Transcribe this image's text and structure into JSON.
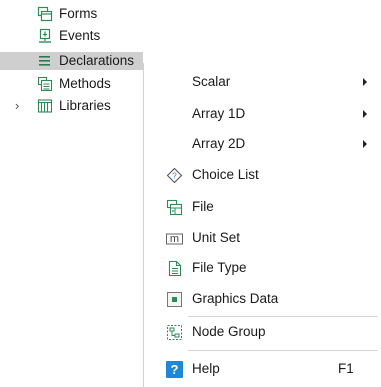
{
  "tree": {
    "items": [
      {
        "label": "Forms",
        "icon": "forms-icon"
      },
      {
        "label": "Events",
        "icon": "events-icon"
      },
      {
        "label": "Declarations",
        "icon": "declarations-icon",
        "selected": true
      },
      {
        "label": "Methods",
        "icon": "methods-icon"
      },
      {
        "label": "Libraries",
        "icon": "libraries-icon",
        "expander": "›"
      }
    ]
  },
  "menu": {
    "items": [
      {
        "label": "Scalar",
        "submenu": true
      },
      {
        "label": "Array 1D",
        "submenu": true
      },
      {
        "label": "Array 2D",
        "submenu": true
      },
      {
        "label": "Choice List",
        "icon": "choice-list-icon"
      },
      {
        "label": "File",
        "icon": "file-icon"
      },
      {
        "label": "Unit Set",
        "icon": "unit-set-icon",
        "icon_text": "m"
      },
      {
        "label": "File Type",
        "icon": "file-type-icon"
      },
      {
        "label": "Graphics Data",
        "icon": "graphics-data-icon"
      },
      {
        "label": "Node Group",
        "icon": "node-group-icon"
      },
      {
        "label": "Help",
        "icon": "help-icon",
        "icon_text": "?",
        "shortcut": "F1"
      }
    ]
  },
  "colors": {
    "accent": "#1e88d6",
    "selection": "#cfcfcf",
    "icon_green": "#2f8a5a"
  }
}
